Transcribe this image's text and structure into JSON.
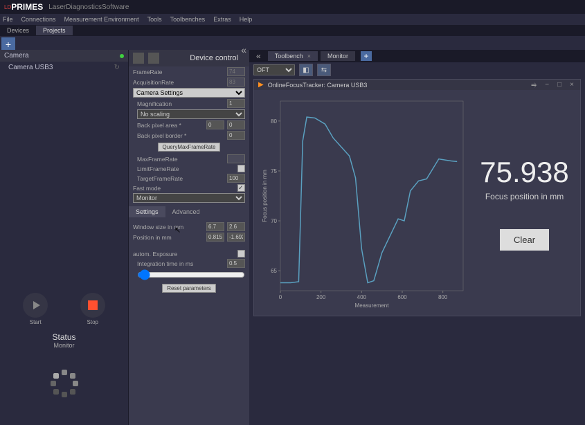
{
  "app": {
    "logo_prefix": "LD",
    "logo": "PRIMES",
    "subtitle": "LaserDiagnosticsSoftware"
  },
  "menubar": [
    "File",
    "Connections",
    "Measurement Environment",
    "Tools",
    "Toolbenches",
    "Extras",
    "Help"
  ],
  "leftTabs": {
    "devices": "Devices",
    "projects": "Projects"
  },
  "camera": {
    "header": "Camera",
    "item": "Camera USB3"
  },
  "controls": {
    "start": "Start",
    "stop": "Stop",
    "status": "Status",
    "statusSub": "Monitor"
  },
  "device": {
    "title": "Device control",
    "frameRateLabel": "FrameRate",
    "frameRateValue": "74",
    "acqRateLabel": "AcquisitionRate",
    "acqRateValue": "83",
    "camSettings": "Camera Settings",
    "magLabel": "Magnification",
    "magValue": "1",
    "scaling": "No scaling",
    "bpAreaLabel": "Back pixel area *",
    "bpArea1": "0",
    "bpArea2": "0",
    "bpBorderLabel": "Back pixel border *",
    "bpBorder1": "0",
    "queryBtn": "QueryMaxFrameRate",
    "maxFRLabel": "MaxFrameRate",
    "limitFRLabel": "LimitFrameRate",
    "targetFRLabel": "TargetFrameRate",
    "targetFRValue": "100",
    "fastModeLabel": "Fast mode",
    "monitor": "Monitor",
    "tabSettings": "Settings",
    "tabAdvanced": "Advanced",
    "winSizeLabel": "Window size in mm",
    "winSize1": "6.7",
    "winSize2": "2.6",
    "posLabel": "Position in mm",
    "pos1": "0.815",
    "pos2": "-1.692",
    "autoExpLabel": "autom. Exposure",
    "intTimeLabel": "Integration time in ms",
    "intTimeValue": "0.5",
    "resetBtn": "Reset parameters"
  },
  "right": {
    "tabToolbench": "Toolbench",
    "tabMonitor": "Monitor",
    "dropdown": "OFT",
    "chartTitle": "OnlineFocusTracker: Camera USB3",
    "readoutValue": "75.938",
    "readoutLabel": "Focus position in mm",
    "clearBtn": "Clear",
    "xlabel": "Measurement",
    "ylabel": "Focus position in mm"
  },
  "chart_data": {
    "type": "line",
    "title": "OnlineFocusTracker: Camera USB3",
    "xlabel": "Measurement",
    "ylabel": "Focus position in mm",
    "xlim": [
      0,
      900
    ],
    "ylim": [
      63,
      82
    ],
    "xticks": [
      0,
      200,
      400,
      600,
      800
    ],
    "yticks": [
      65,
      70,
      75,
      80
    ],
    "x": [
      0,
      50,
      90,
      110,
      130,
      170,
      220,
      260,
      300,
      340,
      370,
      400,
      430,
      460,
      500,
      540,
      580,
      610,
      640,
      680,
      720,
      780,
      840,
      870
    ],
    "y": [
      63.8,
      63.8,
      63.9,
      78.0,
      80.4,
      80.3,
      79.7,
      78.3,
      77.4,
      76.5,
      74.3,
      67.2,
      63.8,
      64.0,
      66.8,
      68.5,
      70.2,
      70.0,
      73.0,
      74.0,
      74.2,
      76.2,
      76.0,
      75.94
    ]
  }
}
